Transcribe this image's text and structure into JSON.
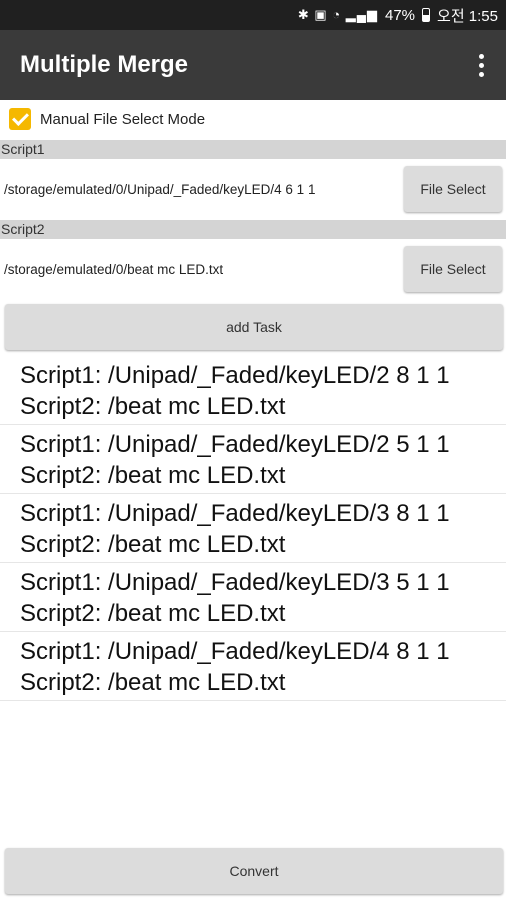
{
  "status_bar": {
    "icons": [
      "bluetooth-icon",
      "nfc-icon",
      "wifi-icon",
      "signal-icon",
      "battery-icon"
    ],
    "battery": "47%",
    "time": "오전 1:55"
  },
  "app_bar": {
    "title": "Multiple Merge"
  },
  "mode": {
    "label": "Manual File Select Mode",
    "checked": true
  },
  "script1": {
    "header": "Script1",
    "path": "/storage/emulated/0/Unipad/_Faded/keyLED/4 6 1 1",
    "button": "File Select"
  },
  "script2": {
    "header": "Script2",
    "path": "/storage/emulated/0/beat mc LED.txt",
    "button": "File Select"
  },
  "add_task": "add Task",
  "tasks": [
    {
      "script1": "Script1: /Unipad/_Faded/keyLED/2 8 1 1",
      "script2": "Script2: /beat mc LED.txt"
    },
    {
      "script1": "Script1: /Unipad/_Faded/keyLED/2 5 1 1",
      "script2": "Script2: /beat mc LED.txt"
    },
    {
      "script1": "Script1: /Unipad/_Faded/keyLED/3 8 1 1",
      "script2": "Script2: /beat mc LED.txt"
    },
    {
      "script1": "Script1: /Unipad/_Faded/keyLED/3 5 1 1",
      "script2": "Script2: /beat mc LED.txt"
    },
    {
      "script1": "Script1: /Unipad/_Faded/keyLED/4 8 1 1",
      "script2": "Script2: /beat mc LED.txt"
    }
  ],
  "convert": "Convert",
  "colors": {
    "accent": "#f5b800",
    "app_bar": "#3a3a3a",
    "section_header": "#d4d4d4"
  }
}
